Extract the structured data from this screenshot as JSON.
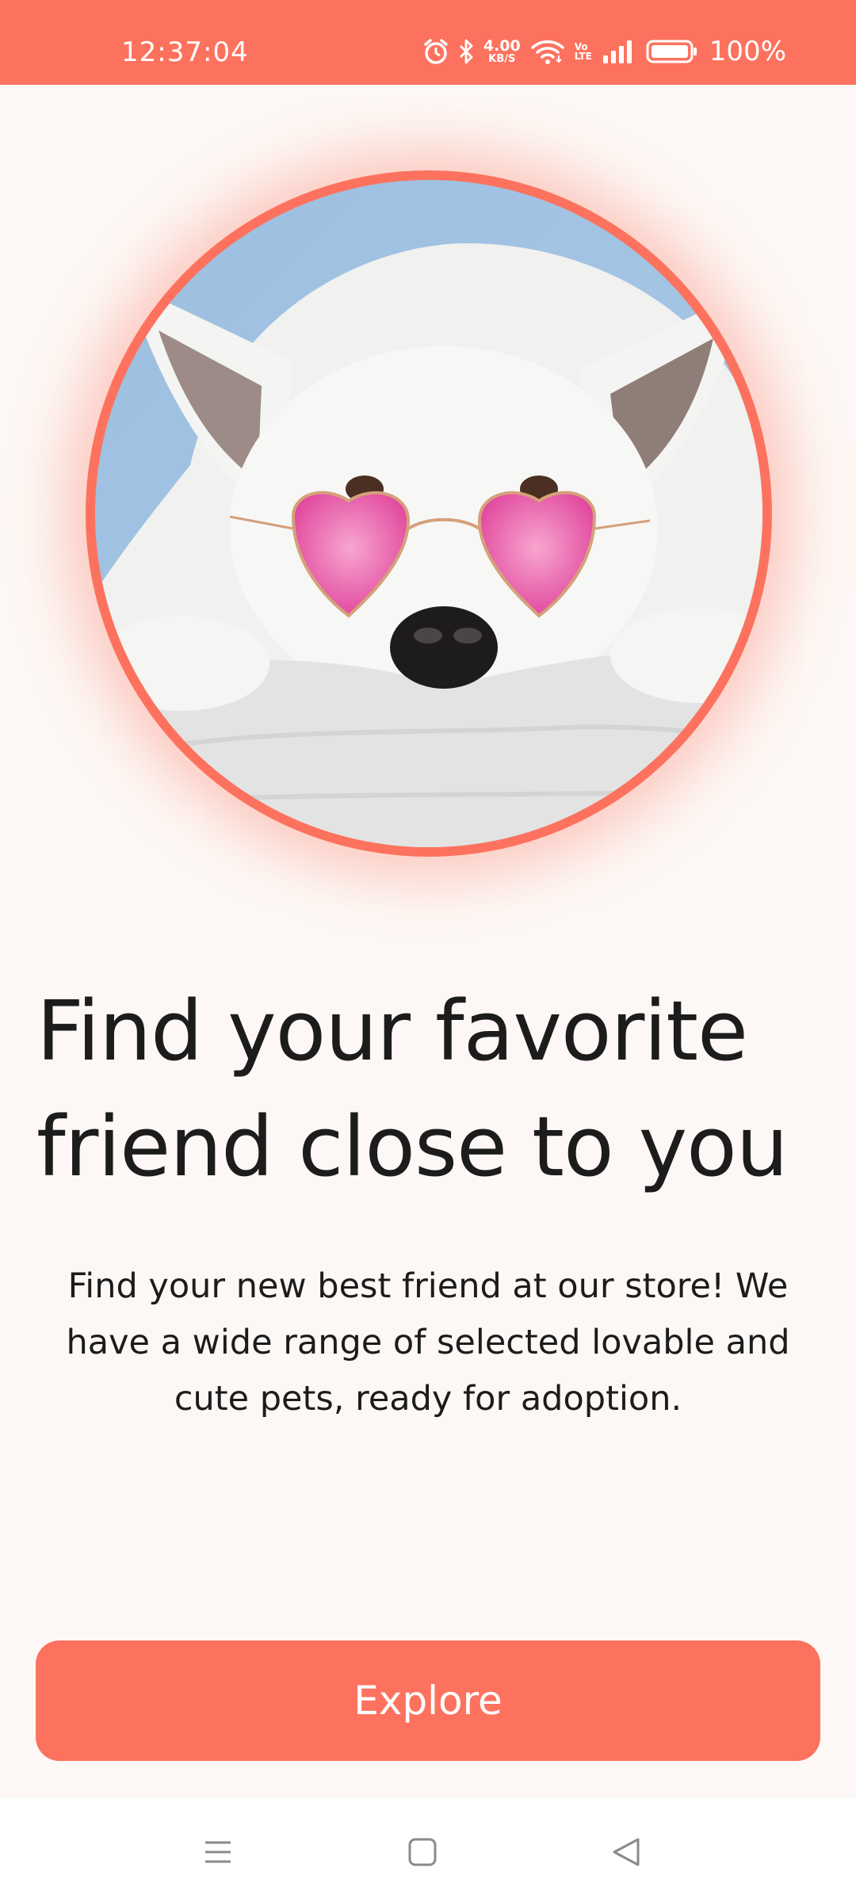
{
  "status_bar": {
    "time": "12:37:04",
    "net_speed_value": "4.00",
    "net_speed_unit": "KB/S",
    "volte_top": "Vo",
    "volte_bottom": "LTE",
    "battery_percent": "100%",
    "icons": [
      "alarm-icon",
      "bluetooth-icon",
      "wifi-icon",
      "signal-icon",
      "battery-icon"
    ]
  },
  "hero": {
    "image_label": "white dog wearing pink heart-shaped sunglasses"
  },
  "content": {
    "headline_line1": "Find your favorite",
    "headline_line2": "friend close to you",
    "description": "Find your new best friend at our store! We have a wide range of selected lovable and cute pets, ready for adoption."
  },
  "actions": {
    "explore_label": "Explore"
  },
  "nav_bar": {
    "icons": [
      "menu-icon",
      "home-icon",
      "back-icon"
    ]
  },
  "colors": {
    "accent": "#fd725e",
    "background": "#fdf8f5",
    "text": "#1c1c1c"
  }
}
